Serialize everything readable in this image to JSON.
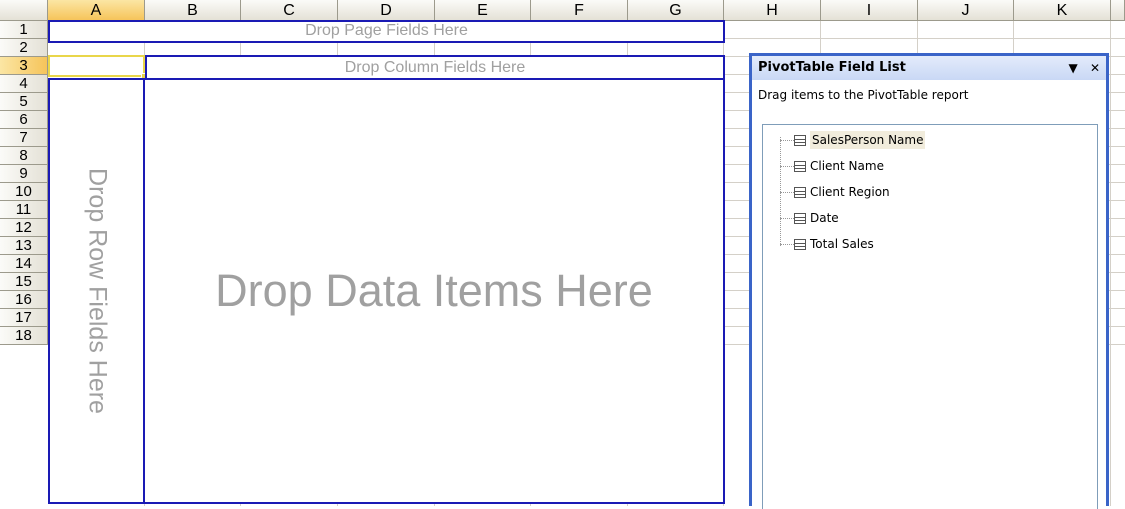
{
  "columns": [
    "A",
    "B",
    "C",
    "D",
    "E",
    "F",
    "G",
    "H",
    "I",
    "J",
    "K"
  ],
  "rows": [
    "1",
    "2",
    "3",
    "4",
    "5",
    "6",
    "7",
    "8",
    "9",
    "10",
    "11",
    "12",
    "13",
    "14",
    "15",
    "16",
    "17",
    "18"
  ],
  "active_cell": {
    "column": "A",
    "row": "3"
  },
  "pivot": {
    "page_zone": "Drop Page Fields Here",
    "column_zone": "Drop Column Fields Here",
    "row_zone": "Drop Row Fields Here",
    "data_zone": "Drop Data Items Here"
  },
  "field_list": {
    "title": "PivotTable Field List",
    "menu_icon": "dropdown-triangle-icon",
    "close_icon": "close-icon",
    "instruction": "Drag items to the PivotTable report",
    "fields": [
      {
        "label": "SalesPerson Name",
        "selected": true
      },
      {
        "label": "Client Name",
        "selected": false
      },
      {
        "label": "Client Region",
        "selected": false
      },
      {
        "label": "Date",
        "selected": false
      },
      {
        "label": "Total Sales",
        "selected": false
      }
    ]
  }
}
